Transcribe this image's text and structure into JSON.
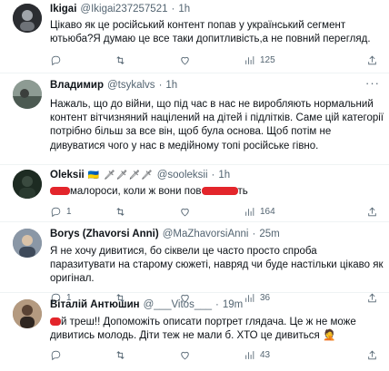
{
  "tweets": [
    {
      "name": "Ikigai",
      "handle": "@Ikigai237257521",
      "time": "1h",
      "text": "Цікаво як це російський контент попав у український сегмент ютьюба?Я думаю це все таки допитливість,а не повний перегляд.",
      "views": "125",
      "colors": {
        "avatar": "#3c3f44"
      }
    },
    {
      "name": "Владимир",
      "handle": "@tsykalvs",
      "time": "1h",
      "text": "Нажаль, що до війни, що під час в нас не виробляють нормальний контент вітчизняний націлений на дітей і підлітків. Саме цій категорії потрібно більш за все він, щоб була основа. Щоб потім не дивуватися чого у нас в медійному топі російське гівно.",
      "colors": {
        "avatar": "#7b8a83"
      }
    },
    {
      "name": "Oleksii",
      "flags": "🇺🇦 🗡🗡🗡🗡",
      "handle": "@sooleksii",
      "time": "1h",
      "text_a": "малороси, коли ж вони пов",
      "text_b": "ть",
      "replies": "1",
      "views": "164",
      "colors": {
        "avatar": "#1d2b22",
        "redaction": "#e3252b"
      }
    },
    {
      "name": "Borys (Zhavorsi Anni)",
      "handle": "@MaZhavorsiAnni",
      "time": "25m",
      "text": "Я не хочу дивитися, бо сіквели це часто просто спроба паразитувати на старому сюжеті, навряд чи буде настільки цікаво як оригінал.",
      "replies": "1",
      "views": "36",
      "colors": {
        "avatar": "#6f7e90"
      }
    },
    {
      "name": "Віталій Антюшин",
      "handle": "@___Vitos___",
      "time": "19m",
      "text_a": "й треш!! Допоможіть описати портрет глядача. Це ж не може дивитись молодь. Діти теж не мали б. ХТО це дивиться ",
      "emoji": "🤦",
      "views": "43",
      "colors": {
        "avatar": "#8b6f57",
        "redaction": "#e3252b"
      }
    }
  ],
  "icons": [
    "reply-icon",
    "retweet-icon",
    "like-icon",
    "views-icon",
    "share-icon",
    "more-icon"
  ]
}
